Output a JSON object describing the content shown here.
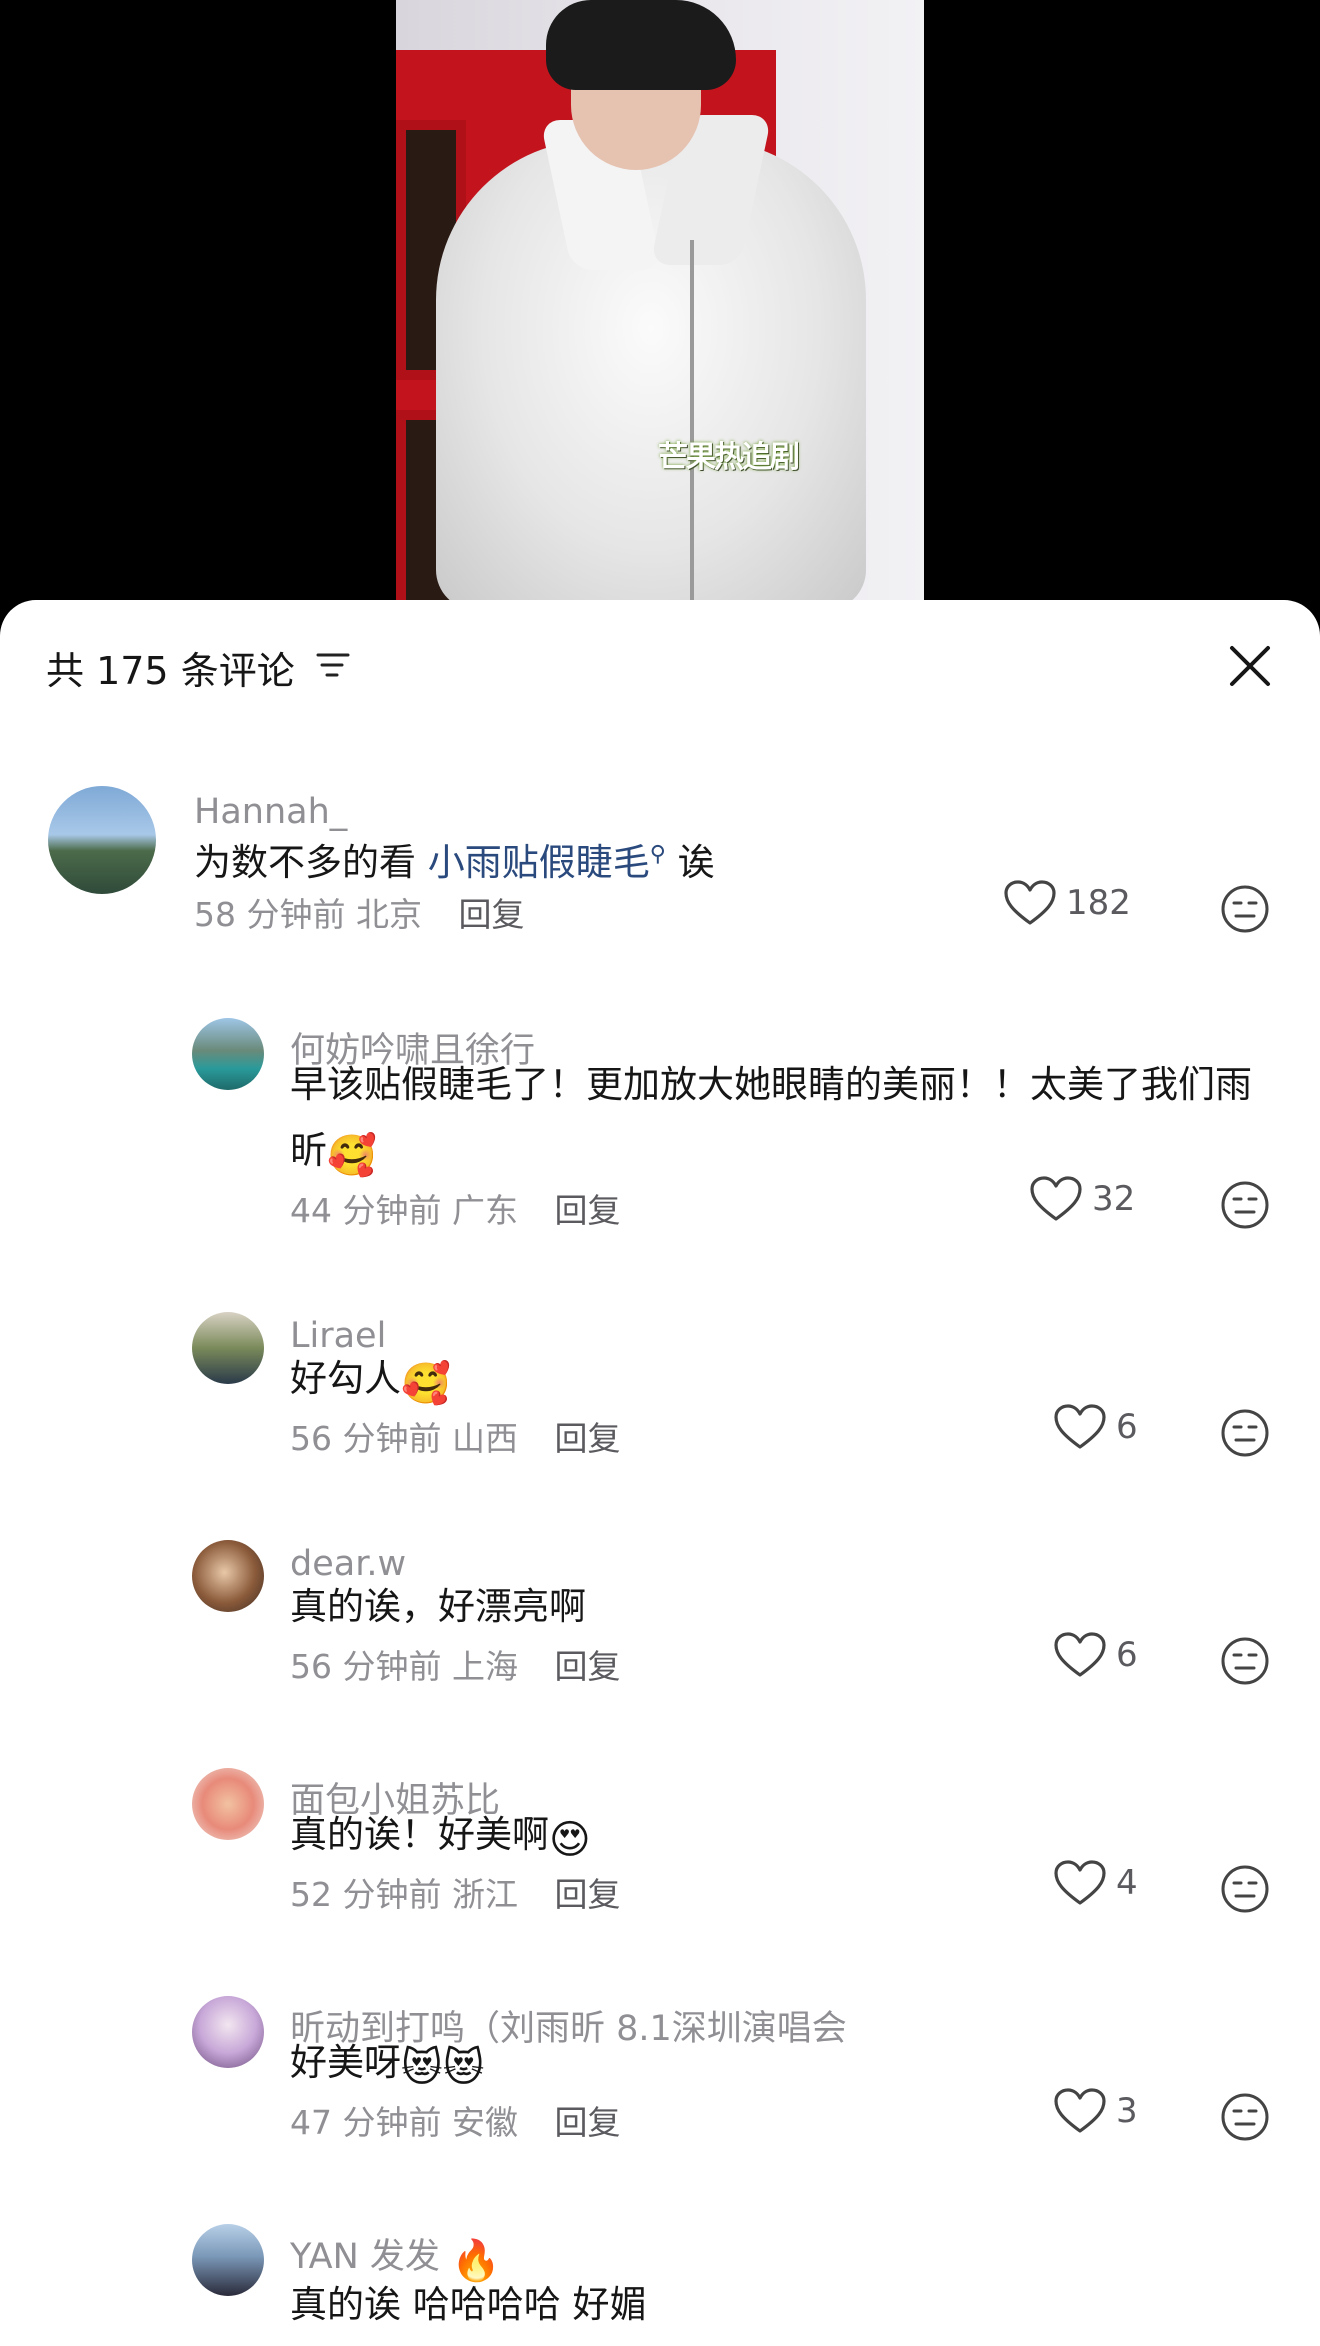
{
  "video": {
    "watermark": "芒果热追剧"
  },
  "comments_panel": {
    "title": "共 175 条评论",
    "filter_icon": "filter-icon",
    "close_icon": "close-icon"
  },
  "reply_label": "回复",
  "comments": [
    {
      "username": "Hannah_",
      "text_before": "为数不多的看 ",
      "link": "小雨贴假睫毛",
      "text_after": " 诶",
      "time": "58 分钟前",
      "location": "北京",
      "likes": "182"
    },
    {
      "username": "何妨吟啸且徐行",
      "text": "早该贴假睫毛了！更加放大她眼睛的美丽！！太美了我们雨昕",
      "emoji": "🥰",
      "time": "44 分钟前",
      "location": "广东",
      "likes": "32"
    },
    {
      "username": "Lirael",
      "text": "好勾人",
      "emoji": "🥰",
      "time": "56 分钟前",
      "location": "山西",
      "likes": "6"
    },
    {
      "username": "dear.w",
      "text": "真的诶，好漂亮啊",
      "time": "56 分钟前",
      "location": "上海",
      "likes": "6"
    },
    {
      "username": "面包小姐苏比",
      "text": "真的诶！好美啊",
      "emoji": "😍",
      "time": "52 分钟前",
      "location": "浙江",
      "likes": "4"
    },
    {
      "username": "昕动到打鸣（刘雨昕 8.1深圳演唱会",
      "text": "好美呀",
      "emoji": "😻😻",
      "time": "47 分钟前",
      "location": "安徽",
      "likes": "3"
    },
    {
      "username": "YAN 发发",
      "username_emoji": "🔥",
      "text": "真的诶 哈哈哈哈 好媚"
    }
  ],
  "colors": {
    "link": "#2a4a7d",
    "muted": "#8f8f94",
    "text": "#161616"
  }
}
